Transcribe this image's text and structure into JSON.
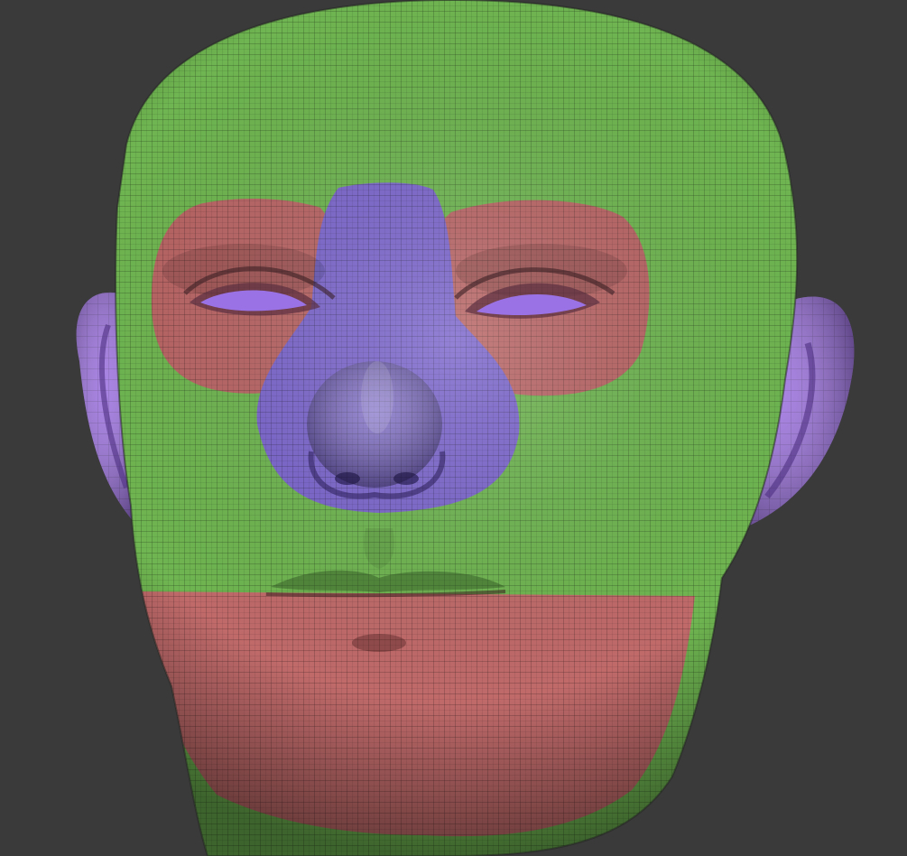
{
  "viewport": {
    "background_color": "#3a3a3a",
    "subject": "sculpted-head-model"
  },
  "polygroups": [
    {
      "name": "base-skin",
      "color": "#6fb551"
    },
    {
      "name": "eye-sockets",
      "color": "#b96565"
    },
    {
      "name": "nose-bridge",
      "color": "#7b66cc"
    },
    {
      "name": "ears",
      "color": "#9a6ee0"
    },
    {
      "name": "lower-face",
      "color": "#c06a6a"
    },
    {
      "name": "eyeballs",
      "color": "#9a72e6"
    }
  ],
  "display": {
    "wireframe_overlay": true,
    "wireframe_color": "#1b1b1b"
  }
}
